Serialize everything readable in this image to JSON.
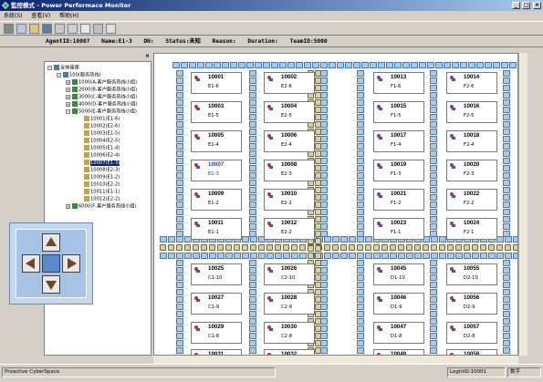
{
  "window": {
    "title": "監控模式 - Power Performace Monitor"
  },
  "menu": [
    "系統(S)",
    "查看(V)",
    "帮助(H)"
  ],
  "agentinfo": {
    "agent": "AgentID:10007",
    "name": "Name:E1-3",
    "dn": "DN:",
    "status": "Status:未知",
    "reason": "Reason:",
    "duration": "Duration:",
    "team": "TeamID:5000"
  },
  "tree": {
    "root": "全体座席",
    "group": "100(服务热线)",
    "items": [
      {
        "label": "1000(A-客户服务热线小组)",
        "level": 2
      },
      {
        "label": "2000(B-客户服务热线小组)",
        "level": 2
      },
      {
        "label": "3000(C-客户服务热线小组)",
        "level": 2
      },
      {
        "label": "4000(D-客户服务热线小组)",
        "level": 2
      },
      {
        "label": "5000(E-客户服务热线小组)",
        "level": 2
      },
      {
        "label": "10001(E1-6)",
        "level": 3
      },
      {
        "label": "10002(E2-6)",
        "level": 3
      },
      {
        "label": "10003(E1-5)",
        "level": 3
      },
      {
        "label": "10004(E2-5)",
        "level": 3
      },
      {
        "label": "10005(E1-4)",
        "level": 3
      },
      {
        "label": "10006(E2-4)",
        "level": 3
      },
      {
        "label": "10007(E1-3)",
        "level": 3,
        "selected": true
      },
      {
        "label": "10008(E2-3)",
        "level": 3
      },
      {
        "label": "10009(E1-2)",
        "level": 3
      },
      {
        "label": "10010(E2-2)",
        "level": 3
      },
      {
        "label": "10011(E1-1)",
        "level": 3
      },
      {
        "label": "10012(E2-2)",
        "level": 3
      },
      {
        "label": "6000(F-客户服务热线小组)",
        "level": 2
      }
    ]
  },
  "cards": [
    {
      "id": "10001",
      "name": "E1-6",
      "col": 0,
      "row": 0
    },
    {
      "id": "10002",
      "name": "E2-6",
      "col": 1,
      "row": 0
    },
    {
      "id": "10013",
      "name": "F1-6",
      "col": 2,
      "row": 0
    },
    {
      "id": "10014",
      "name": "F2-6",
      "col": 3,
      "row": 0
    },
    {
      "id": "10003",
      "name": "E1-5",
      "col": 0,
      "row": 1
    },
    {
      "id": "10004",
      "name": "E2-5",
      "col": 1,
      "row": 1
    },
    {
      "id": "10015",
      "name": "F1-5",
      "col": 2,
      "row": 1
    },
    {
      "id": "10016",
      "name": "F2-5",
      "col": 3,
      "row": 1
    },
    {
      "id": "10005",
      "name": "E1-4",
      "col": 0,
      "row": 2
    },
    {
      "id": "10006",
      "name": "E2-4",
      "col": 1,
      "row": 2
    },
    {
      "id": "10017",
      "name": "F1-4",
      "col": 2,
      "row": 2
    },
    {
      "id": "10018",
      "name": "F2-4",
      "col": 3,
      "row": 2
    },
    {
      "id": "10007",
      "name": "E1-3",
      "col": 0,
      "row": 3,
      "blue": true
    },
    {
      "id": "10008",
      "name": "E2-3",
      "col": 1,
      "row": 3
    },
    {
      "id": "10019",
      "name": "F1-3",
      "col": 2,
      "row": 3
    },
    {
      "id": "10020",
      "name": "F2-3",
      "col": 3,
      "row": 3
    },
    {
      "id": "10009",
      "name": "E1-2",
      "col": 0,
      "row": 4
    },
    {
      "id": "10010",
      "name": "E2-2",
      "col": 1,
      "row": 4
    },
    {
      "id": "10021",
      "name": "F1-2",
      "col": 2,
      "row": 4
    },
    {
      "id": "10022",
      "name": "F2-2",
      "col": 3,
      "row": 4
    },
    {
      "id": "10011",
      "name": "E1-1",
      "col": 0,
      "row": 5
    },
    {
      "id": "10012",
      "name": "E2-2",
      "col": 1,
      "row": 5
    },
    {
      "id": "10023",
      "name": "F1-1",
      "col": 2,
      "row": 5
    },
    {
      "id": "10024",
      "name": "F2-1",
      "col": 3,
      "row": 5
    },
    {
      "id": "10025",
      "name": "C1-10",
      "col": 0,
      "row": 6
    },
    {
      "id": "10026",
      "name": "C2-10",
      "col": 1,
      "row": 6
    },
    {
      "id": "10045",
      "name": "D1-10",
      "col": 2,
      "row": 6
    },
    {
      "id": "10055",
      "name": "D2-10",
      "col": 3,
      "row": 6
    },
    {
      "id": "10027",
      "name": "C1-9",
      "col": 0,
      "row": 7
    },
    {
      "id": "10028",
      "name": "C2-9",
      "col": 1,
      "row": 7
    },
    {
      "id": "10046",
      "name": "D1-9",
      "col": 2,
      "row": 7
    },
    {
      "id": "10056",
      "name": "D2-9",
      "col": 3,
      "row": 7
    },
    {
      "id": "10029",
      "name": "C1-8",
      "col": 0,
      "row": 8
    },
    {
      "id": "10030",
      "name": "C2-8",
      "col": 1,
      "row": 8
    },
    {
      "id": "10047",
      "name": "D1-8",
      "col": 2,
      "row": 8
    },
    {
      "id": "10057",
      "name": "D2-8",
      "col": 3,
      "row": 8
    },
    {
      "id": "10031",
      "name": "",
      "col": 0,
      "row": 9
    },
    {
      "id": "10032",
      "name": "",
      "col": 1,
      "row": 9
    },
    {
      "id": "10048",
      "name": "",
      "col": 2,
      "row": 9
    },
    {
      "id": "10058",
      "name": "",
      "col": 3,
      "row": 9
    }
  ],
  "statusbar": {
    "company": "Proactive CyberSpace",
    "login": "LoginID:10001",
    "mode": "数字"
  },
  "colors": {
    "titlebar": "#0a246a",
    "seat": "#a9c9ec",
    "selected": "#1a3ad0"
  }
}
